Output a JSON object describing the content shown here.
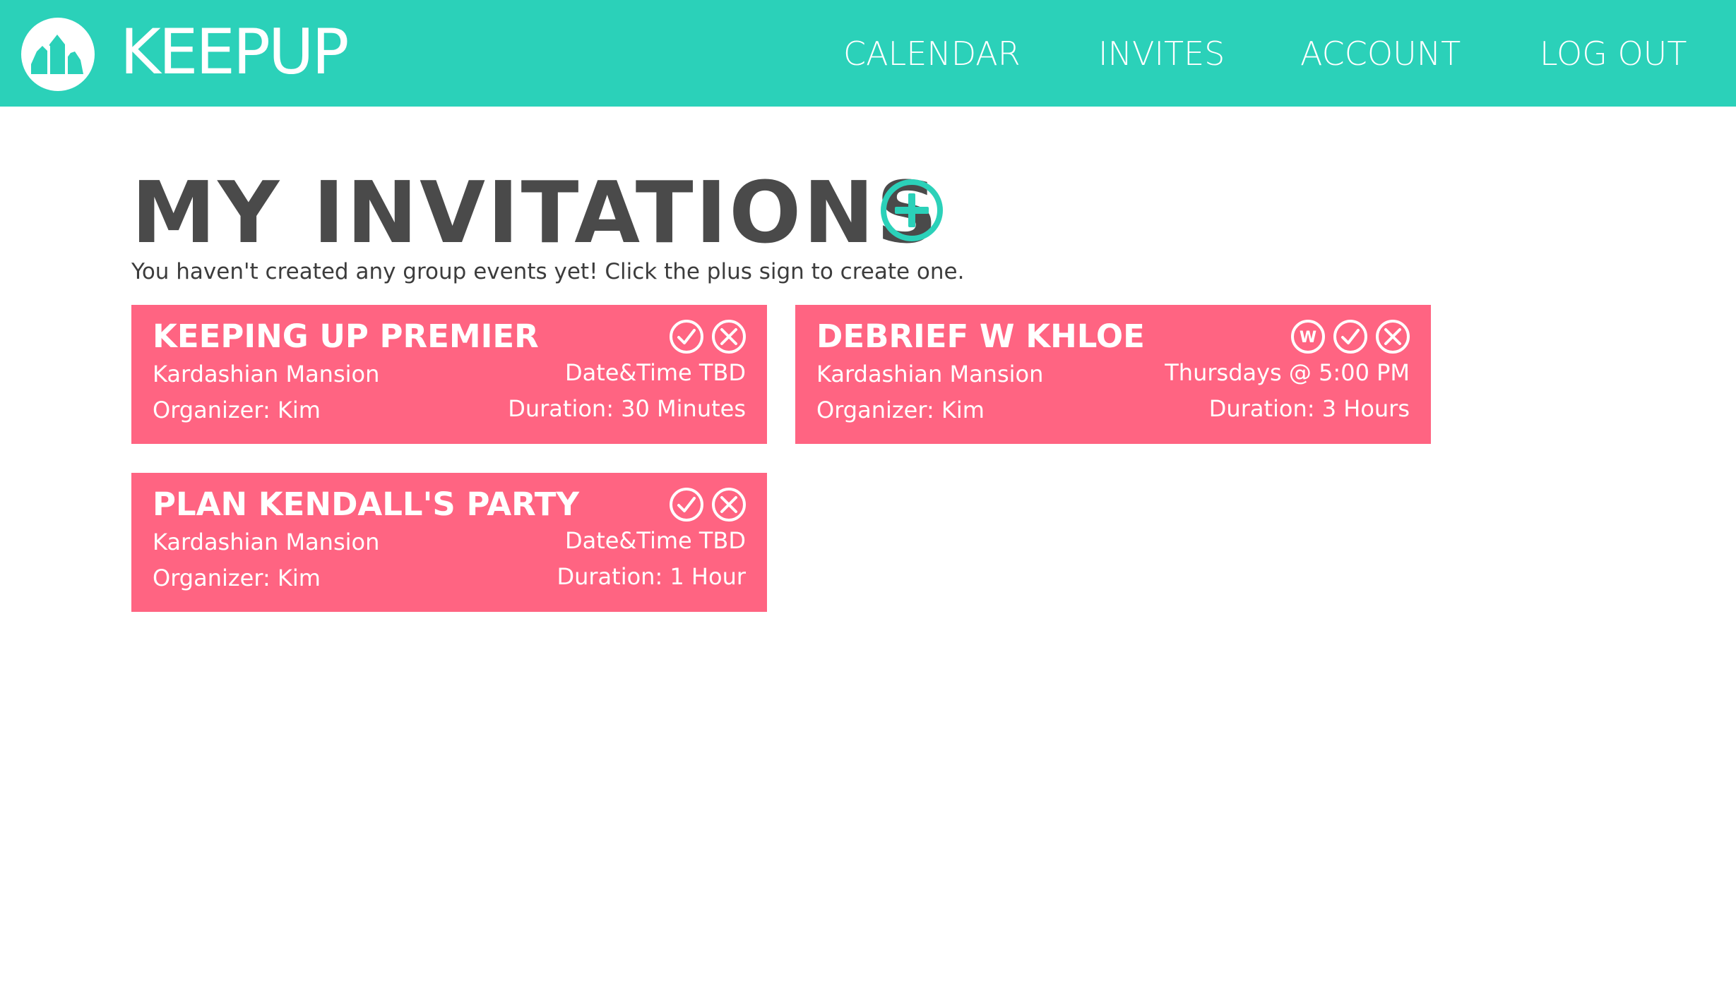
{
  "colors": {
    "nav_background": "#2bd1b9",
    "card_background": "#ff6482",
    "accent": "#2bd1b9",
    "title_text": "#4a4a4a"
  },
  "nav": {
    "brand": "KEEPUP",
    "logo_icon": "mountains-logo-icon",
    "links": [
      "CALENDAR",
      "INVITES",
      "ACCOUNT",
      "LOG OUT"
    ]
  },
  "main": {
    "title": "MY INVITATIONS",
    "add_icon": "plus-circle-icon",
    "subtitle": "You haven't created any group events yet! Click the plus sign to create one."
  },
  "invitations": [
    {
      "title": "KEEPING UP PREMIER",
      "location": "Kardashian Mansion",
      "organizer": "Organizer: Kim",
      "time": "Date&Time TBD",
      "duration": "Duration: 30 Minutes",
      "actions": [
        "check-circle-icon",
        "x-circle-icon"
      ]
    },
    {
      "title": "DEBRIEF W KHLOE",
      "location": "Kardashian Mansion",
      "organizer": "Organizer: Kim",
      "time": "Thursdays @ 5:00 PM",
      "duration": "Duration: 3 Hours",
      "actions": [
        "w-circle-icon",
        "check-circle-icon",
        "x-circle-icon"
      ],
      "w_icon_letter": "W"
    },
    {
      "title": "PLAN KENDALL'S PARTY",
      "location": "Kardashian Mansion",
      "organizer": "Organizer: Kim",
      "time": "Date&Time TBD",
      "duration": "Duration: 1 Hour",
      "actions": [
        "check-circle-icon",
        "x-circle-icon"
      ]
    }
  ]
}
